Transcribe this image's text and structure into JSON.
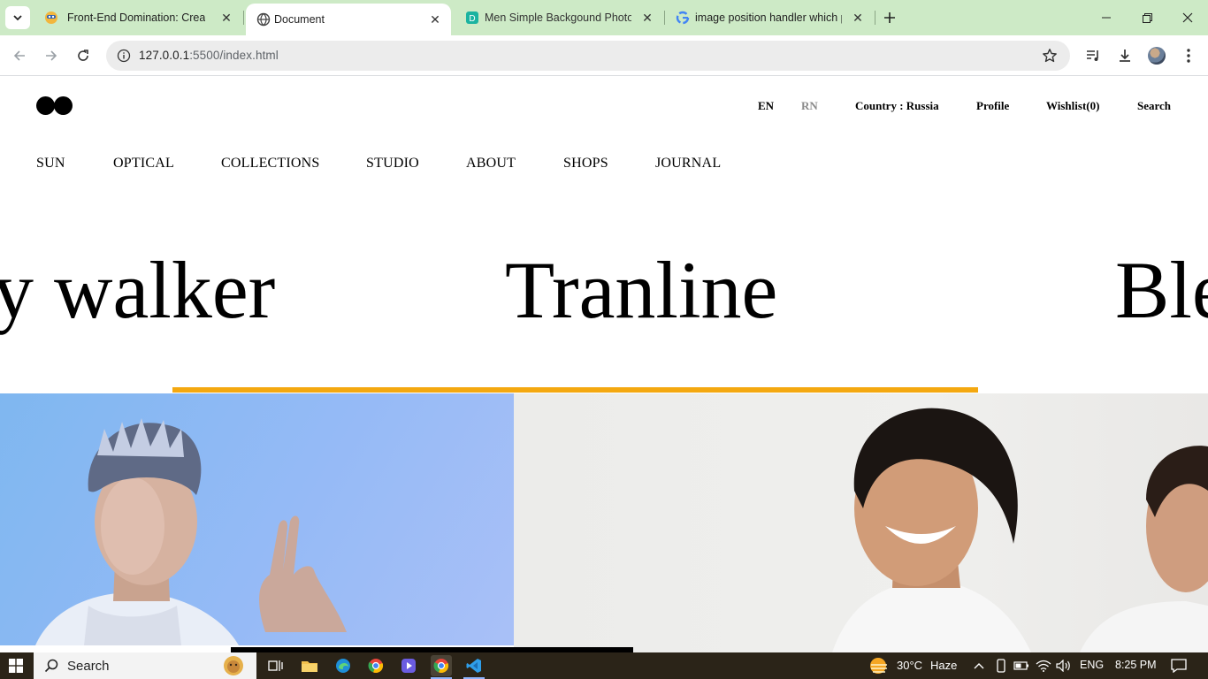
{
  "browser": {
    "tabs": [
      {
        "title": "Front-End Domination: Create A",
        "active": false
      },
      {
        "title": "Document",
        "active": true
      },
      {
        "title": "Men Simple Backgound Photos",
        "active": false
      },
      {
        "title": "image position handler which p",
        "active": false
      }
    ],
    "url_host": "127.0.0.1",
    "url_rest": ":5500/index.html"
  },
  "site": {
    "utility_nav": {
      "lang_en": "EN",
      "lang_rn": "RN",
      "country": "Country : Russia",
      "profile": "Profile",
      "wishlist": "Wishlist(0)",
      "search": "Search"
    },
    "main_nav": [
      "SUN",
      "OPTICAL",
      "COLLECTIONS",
      "STUDIO",
      "ABOUT",
      "SHOPS",
      "JOURNAL"
    ],
    "marquee": [
      "y walker",
      "Tranline",
      "Ble"
    ]
  },
  "taskbar": {
    "search_label": "Search",
    "weather_temp": "30°C",
    "weather_text": "Haze",
    "lang": "ENG",
    "time": "8:25 PM"
  },
  "colors": {
    "accent": "#f4a810",
    "tabstrip": "#cdeac6",
    "taskbar": "#2b2418"
  }
}
